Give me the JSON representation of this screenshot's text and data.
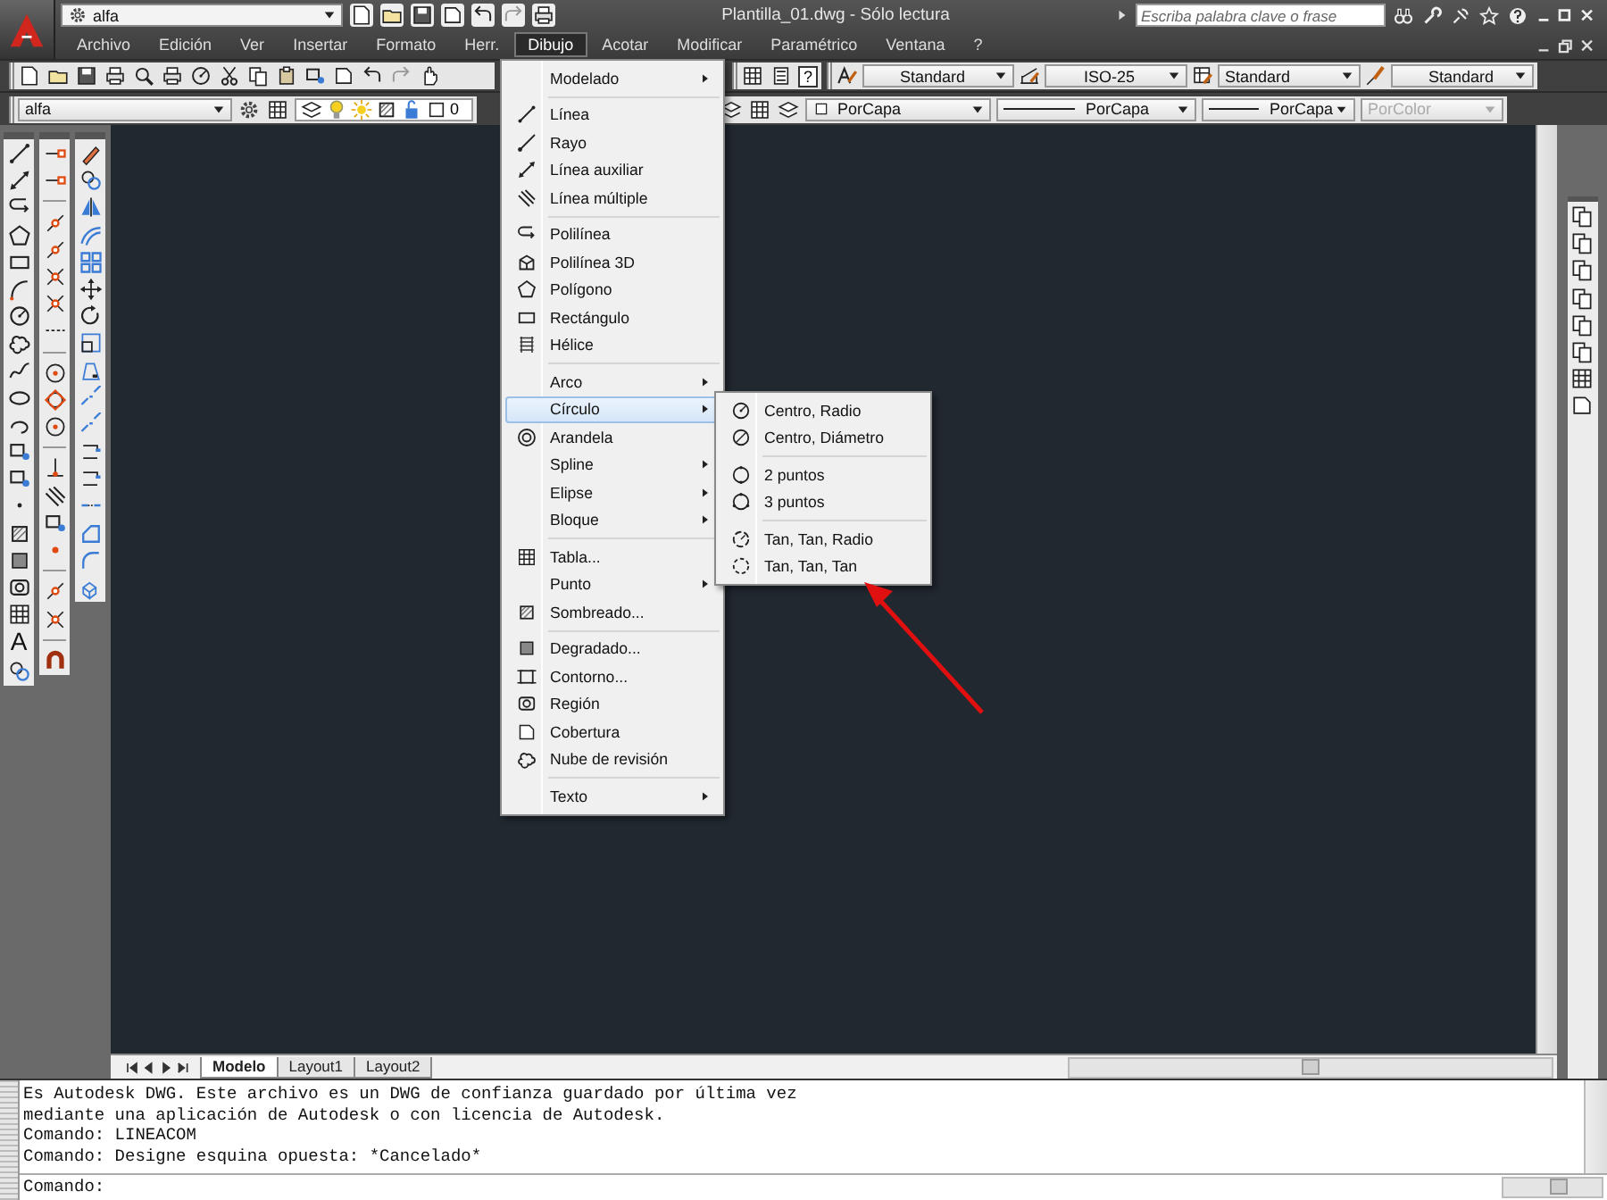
{
  "app": {
    "title": "Plantilla_01.dwg - Sólo lectura",
    "workspace": "alfa",
    "search": {
      "placeholder": "Escriba palabra clave o frase"
    }
  },
  "menubar": [
    {
      "label": "Archivo",
      "selected": false
    },
    {
      "label": "Edición",
      "selected": false
    },
    {
      "label": "Ver",
      "selected": false
    },
    {
      "label": "Insertar",
      "selected": false
    },
    {
      "label": "Formato",
      "selected": false
    },
    {
      "label": "Herr.",
      "selected": false
    },
    {
      "label": "Dibujo",
      "selected": true
    },
    {
      "label": "Acotar",
      "selected": false
    },
    {
      "label": "Modificar",
      "selected": false
    },
    {
      "label": "Paramétrico",
      "selected": false
    },
    {
      "label": "Ventana",
      "selected": false
    },
    {
      "label": "?",
      "selected": false
    }
  ],
  "styles_toolbar": {
    "help_glyph": "?",
    "text_style": "Standard",
    "dim_style": "ISO-25",
    "table_style": "Standard",
    "multileader_style": "Standard"
  },
  "layers_toolbar": {
    "layer": "alfa",
    "current_layer": "0"
  },
  "properties_toolbar": {
    "color_setting": "PorCapa",
    "linetype": "PorCapa",
    "lineweight": "PorCapa",
    "plot_style": {
      "value": "PorColor",
      "disabled": true
    }
  },
  "draw_menu": {
    "groups": [
      [
        {
          "label": "Modelado",
          "has_submenu": true,
          "selected": false
        }
      ],
      [
        {
          "label": "Línea",
          "has_submenu": false,
          "selected": false
        },
        {
          "label": "Rayo",
          "has_submenu": false,
          "selected": false
        },
        {
          "label": "Línea auxiliar",
          "has_submenu": false,
          "selected": false
        },
        {
          "label": "Línea múltiple",
          "has_submenu": false,
          "selected": false
        }
      ],
      [
        {
          "label": "Polilínea",
          "has_submenu": false,
          "selected": false
        },
        {
          "label": "Polilínea 3D",
          "has_submenu": false,
          "selected": false
        },
        {
          "label": "Polígono",
          "has_submenu": false,
          "selected": false
        },
        {
          "label": "Rectángulo",
          "has_submenu": false,
          "selected": false
        },
        {
          "label": "Hélice",
          "has_submenu": false,
          "selected": false
        }
      ],
      [
        {
          "label": "Arco",
          "has_submenu": true,
          "selected": false
        },
        {
          "label": "Círculo",
          "has_submenu": true,
          "selected": true
        },
        {
          "label": "Arandela",
          "has_submenu": false,
          "selected": false
        },
        {
          "label": "Spline",
          "has_submenu": true,
          "selected": false
        },
        {
          "label": "Elipse",
          "has_submenu": true,
          "selected": false
        },
        {
          "label": "Bloque",
          "has_submenu": true,
          "selected": false
        }
      ],
      [
        {
          "label": "Tabla...",
          "has_submenu": false,
          "selected": false
        },
        {
          "label": "Punto",
          "has_submenu": true,
          "selected": false
        },
        {
          "label": "Sombreado...",
          "has_submenu": false,
          "selected": false
        }
      ],
      [
        {
          "label": "Degradado...",
          "has_submenu": false,
          "selected": false
        },
        {
          "label": "Contorno...",
          "has_submenu": false,
          "selected": false
        },
        {
          "label": "Región",
          "has_submenu": false,
          "selected": false
        },
        {
          "label": "Cobertura",
          "has_submenu": false,
          "selected": false
        },
        {
          "label": "Nube de revisión",
          "has_submenu": false,
          "selected": false
        }
      ],
      [
        {
          "label": "Texto",
          "has_submenu": true,
          "selected": false
        }
      ]
    ]
  },
  "circle_submenu": {
    "groups": [
      [
        {
          "label": "Centro, Radio",
          "selected": false
        },
        {
          "label": "Centro, Diámetro",
          "selected": false
        }
      ],
      [
        {
          "label": "2 puntos",
          "selected": false
        },
        {
          "label": "3 puntos",
          "selected": false
        }
      ],
      [
        {
          "label": "Tan, Tan, Radio",
          "selected": false
        },
        {
          "label": "Tan, Tan, Tan",
          "selected": false
        }
      ]
    ]
  },
  "draw_toolbar": {
    "text_tool": "A"
  },
  "layout_tabs": [
    {
      "label": "Modelo",
      "selected": true
    },
    {
      "label": "Layout1",
      "selected": false
    },
    {
      "label": "Layout2",
      "selected": false
    }
  ],
  "command_line": {
    "history": [
      "Es Autodesk DWG. Este archivo es un DWG de confianza guardado por última vez",
      "mediante una aplicación de Autodesk o con licencia de Autodesk.",
      "Comando: LINEACOM",
      "Comando: Designe esquina opuesta: *Cancelado*"
    ],
    "prompt": "Comando:"
  }
}
